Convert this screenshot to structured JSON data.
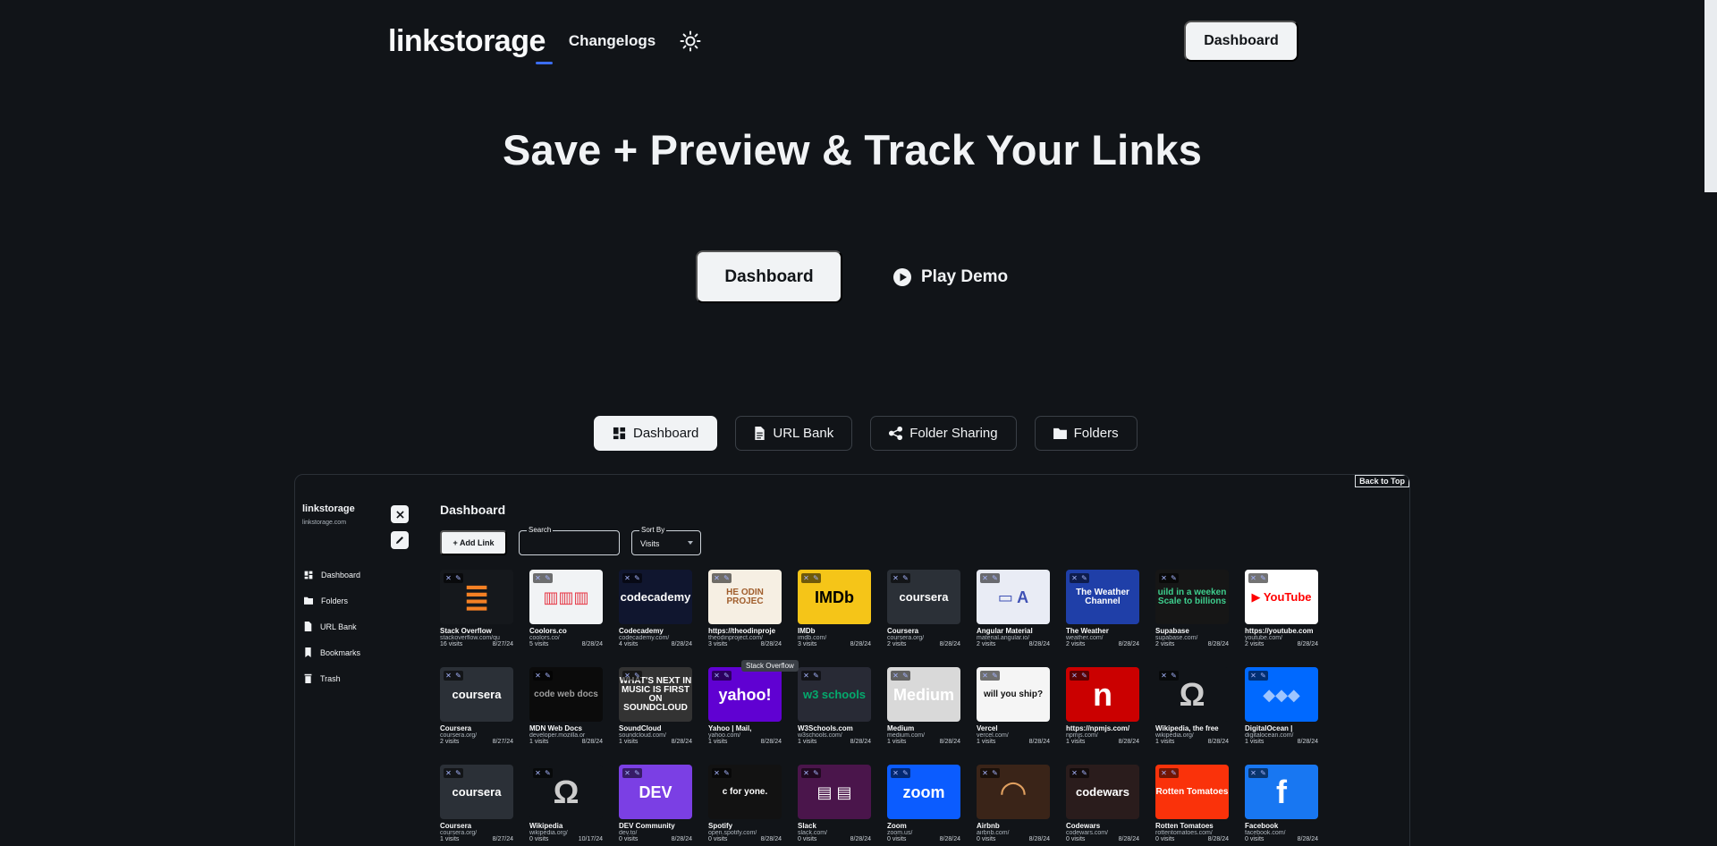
{
  "nav": {
    "brand": "linkstorage",
    "changelogs": "Changelogs",
    "theme_icon": "sun-icon",
    "dashboard": "Dashboard"
  },
  "hero": {
    "title": "Save + Preview & Track Your Links",
    "dashboard": "Dashboard",
    "play_demo": "Play Demo"
  },
  "tabs": [
    {
      "label": "Dashboard",
      "icon": "dashboard-icon",
      "active": true
    },
    {
      "label": "URL Bank",
      "icon": "document-icon",
      "active": false
    },
    {
      "label": "Folder Sharing",
      "icon": "share-icon",
      "active": false
    },
    {
      "label": "Folders",
      "icon": "folder-icon",
      "active": false
    }
  ],
  "preview": {
    "back_to_top": "Back to Top",
    "sidebar": {
      "brand": "linkstorage",
      "subtitle": "linkstorage.com",
      "items": [
        {
          "label": "Dashboard",
          "icon": "dashboard-icon"
        },
        {
          "label": "Folders",
          "icon": "folder-icon"
        },
        {
          "label": "URL Bank",
          "icon": "document-icon"
        },
        {
          "label": "Bookmarks",
          "icon": "bookmark-icon"
        },
        {
          "label": "Trash",
          "icon": "trash-icon"
        }
      ]
    },
    "title": "Dashboard",
    "add_link": "+ Add Link",
    "search_label": "Search",
    "sort_label": "Sort By",
    "sort_value": "Visits",
    "tooltip": "Stack Overflow",
    "cards": [
      {
        "title": "Stack Overflow",
        "url": "stackoverflow.com/qu",
        "visits": "16 visits",
        "date": "8/27/24",
        "bg": "#15181c",
        "fg": "#f48024",
        "thumb": "≣"
      },
      {
        "title": "Coolors.co",
        "url": "coolors.co/",
        "visits": "5 visits",
        "date": "8/28/24",
        "bg": "#f1f3f5",
        "fg": "#e63946",
        "thumb": "▥▥▥"
      },
      {
        "title": "Codecademy",
        "url": "codecademy.com/",
        "visits": "4 visits",
        "date": "8/28/24",
        "bg": "#10162f",
        "fg": "#ffffff",
        "thumb": "codecademy"
      },
      {
        "title": "https://theodinproje",
        "url": "theodinproject.com/",
        "visits": "3 visits",
        "date": "8/28/24",
        "bg": "#f6efe3",
        "fg": "#a05d2c",
        "thumb": "HE ODIN PROJEC"
      },
      {
        "title": "IMDb",
        "url": "imdb.com/",
        "visits": "3 visits",
        "date": "8/28/24",
        "bg": "#f5c518",
        "fg": "#000000",
        "thumb": "IMDb"
      },
      {
        "title": "Coursera",
        "url": "coursera.org/",
        "visits": "2 visits",
        "date": "8/28/24",
        "bg": "#2b3037",
        "fg": "#ffffff",
        "thumb": "coursera"
      },
      {
        "title": "Angular Material",
        "url": "material.angular.io/",
        "visits": "2 visits",
        "date": "8/28/24",
        "bg": "#e9ecf5",
        "fg": "#3f51b5",
        "thumb": "▭ A"
      },
      {
        "title": "The Weather",
        "url": "weather.com/",
        "visits": "2 visits",
        "date": "8/28/24",
        "bg": "#1f3fa8",
        "fg": "#ffffff",
        "thumb": "The Weather Channel"
      },
      {
        "title": "Supabase",
        "url": "supabase.com/",
        "visits": "2 visits",
        "date": "8/28/24",
        "bg": "#161616",
        "fg": "#3ecf8e",
        "thumb": "uild in a weeken Scale to billions"
      },
      {
        "title": "https://youtube.com",
        "url": "youtube.com/",
        "visits": "2 visits",
        "date": "8/28/24",
        "bg": "#ffffff",
        "fg": "#ff0000",
        "thumb": "▶ YouTube"
      },
      {
        "title": "Coursera",
        "url": "coursera.org/",
        "visits": "2 visits",
        "date": "8/27/24",
        "bg": "#2b3037",
        "fg": "#ffffff",
        "thumb": "coursera"
      },
      {
        "title": "MDN Web Docs",
        "url": "developer.mozilla.or",
        "visits": "1 visits",
        "date": "8/28/24",
        "bg": "#0b0b0b",
        "fg": "#9e9e9e",
        "thumb": "code web docs"
      },
      {
        "title": "SoundCloud",
        "url": "soundcloud.com/",
        "visits": "1 visits",
        "date": "8/28/24",
        "bg": "#333333",
        "fg": "#ffffff",
        "thumb": "WHAT'S NEXT IN MUSIC IS FIRST ON SOUNDCLOUD"
      },
      {
        "title": "Yahoo | Mail,",
        "url": "yahoo.com/",
        "visits": "1 visits",
        "date": "8/28/24",
        "bg": "#6001d2",
        "fg": "#ffffff",
        "thumb": "yahoo!"
      },
      {
        "title": "W3Schools.com",
        "url": "w3schools.com/",
        "visits": "1 visits",
        "date": "8/28/24",
        "bg": "#282a35",
        "fg": "#04aa6d",
        "thumb": "w3 schools"
      },
      {
        "title": "Medium",
        "url": "medium.com/",
        "visits": "1 visits",
        "date": "8/28/24",
        "bg": "#d9d9d9",
        "fg": "#ffffff",
        "thumb": "Medium"
      },
      {
        "title": "Vercel",
        "url": "vercel.com/",
        "visits": "1 visits",
        "date": "8/28/24",
        "bg": "#f5f5f5",
        "fg": "#111111",
        "thumb": "will you ship?"
      },
      {
        "title": "https://npmjs.com/",
        "url": "npmjs.com/",
        "visits": "1 visits",
        "date": "8/28/24",
        "bg": "#cb0000",
        "fg": "#ffffff",
        "thumb": "n"
      },
      {
        "title": "Wikipedia, the free",
        "url": "wikipedia.org/",
        "visits": "1 visits",
        "date": "8/28/24",
        "bg": "#111418",
        "fg": "#cccccc",
        "thumb": "Ω"
      },
      {
        "title": "DigitalOcean |",
        "url": "digitalocean.com/",
        "visits": "1 visits",
        "date": "8/28/24",
        "bg": "#0069ff",
        "fg": "#9ec5ff",
        "thumb": "◆◆◆"
      },
      {
        "title": "Coursera",
        "url": "coursera.org/",
        "visits": "1 visits",
        "date": "8/27/24",
        "bg": "#2b3037",
        "fg": "#ffffff",
        "thumb": "coursera"
      },
      {
        "title": "Wikipedia",
        "url": "wikipedia.org/",
        "visits": "0 visits",
        "date": "10/17/24",
        "bg": "#111418",
        "fg": "#cccccc",
        "thumb": "Ω"
      },
      {
        "title": "DEV Community",
        "url": "dev.to/",
        "visits": "0 visits",
        "date": "8/28/24",
        "bg": "#7b3fe4",
        "fg": "#ffffff",
        "thumb": "DEV"
      },
      {
        "title": "Spotify",
        "url": "open.spotify.com/",
        "visits": "0 visits",
        "date": "8/28/24",
        "bg": "#121212",
        "fg": "#ffffff",
        "thumb": "c for yone."
      },
      {
        "title": "Slack",
        "url": "slack.com/",
        "visits": "0 visits",
        "date": "8/28/24",
        "bg": "#4a154b",
        "fg": "#ffffff",
        "thumb": "▤ ▤"
      },
      {
        "title": "Zoom",
        "url": "zoom.us/",
        "visits": "0 visits",
        "date": "8/28/24",
        "bg": "#0b5cff",
        "fg": "#ffffff",
        "thumb": "zoom"
      },
      {
        "title": "Airbnb",
        "url": "airbnb.com/",
        "visits": "0 visits",
        "date": "8/28/24",
        "bg": "#3a2418",
        "fg": "#e0a060",
        "thumb": "◠"
      },
      {
        "title": "Codewars",
        "url": "codewars.com/",
        "visits": "0 visits",
        "date": "8/28/24",
        "bg": "#2a1c1c",
        "fg": "#ffffff",
        "thumb": "codewars"
      },
      {
        "title": "Rotten Tomatoes",
        "url": "rottentomatoes.com/",
        "visits": "0 visits",
        "date": "8/28/24",
        "bg": "#fa320a",
        "fg": "#ffffff",
        "thumb": "Rotten Tomatoes"
      },
      {
        "title": "Facebook",
        "url": "facebook.com/",
        "visits": "0 visits",
        "date": "8/28/24",
        "bg": "#1877f2",
        "fg": "#ffffff",
        "thumb": "f"
      }
    ]
  }
}
